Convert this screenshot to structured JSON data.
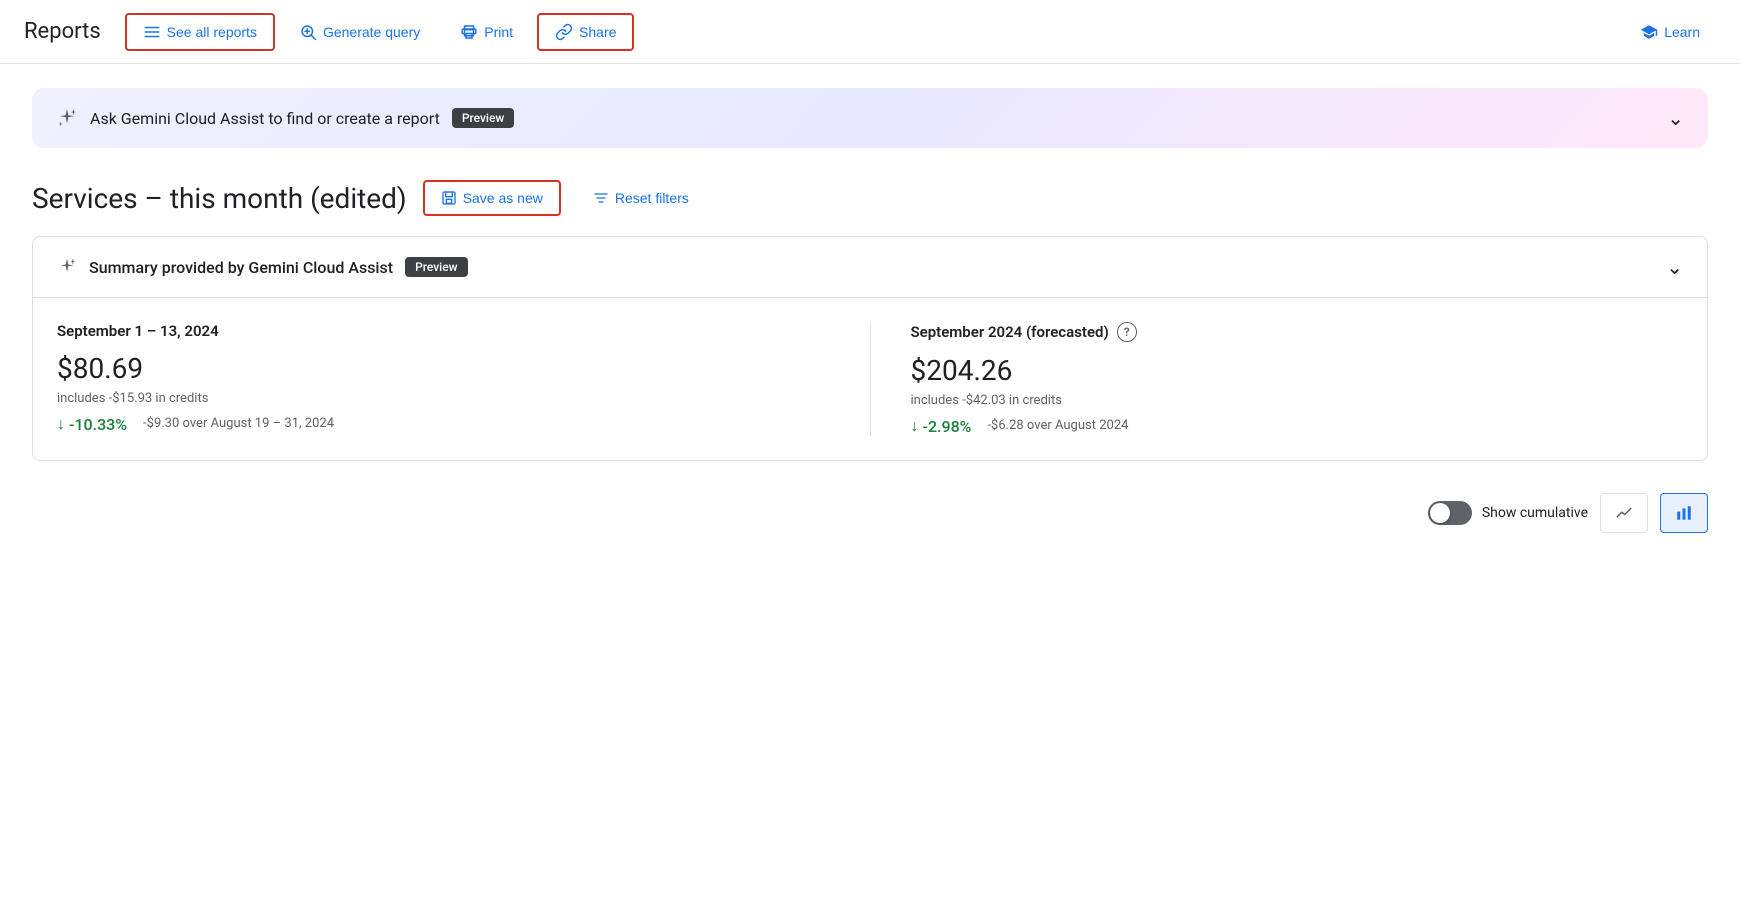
{
  "nav": {
    "title": "Reports",
    "see_all_reports": "See all reports",
    "generate_query": "Generate query",
    "print": "Print",
    "share": "Share",
    "learn": "Learn"
  },
  "gemini_banner": {
    "text": "Ask Gemini Cloud Assist to find or create a report",
    "badge": "Preview"
  },
  "report": {
    "title": "Services – this month (edited)",
    "save_as_new": "Save as new",
    "reset_filters": "Reset filters"
  },
  "summary_card": {
    "header": "Summary provided by Gemini Cloud Assist",
    "badge": "Preview",
    "section1": {
      "period": "September 1 – 13, 2024",
      "amount": "$80.69",
      "credits": "includes -$15.93 in credits",
      "change_pct": "-10.33%",
      "change_detail": "-$9.30 over August 19 – 31, 2024"
    },
    "section2": {
      "period": "September 2024 (forecasted)",
      "amount": "$204.26",
      "credits": "includes -$42.03 in credits",
      "change_pct": "-2.98%",
      "change_detail": "-$6.28 over August 2024"
    }
  },
  "bottom_controls": {
    "show_cumulative": "Show cumulative"
  }
}
